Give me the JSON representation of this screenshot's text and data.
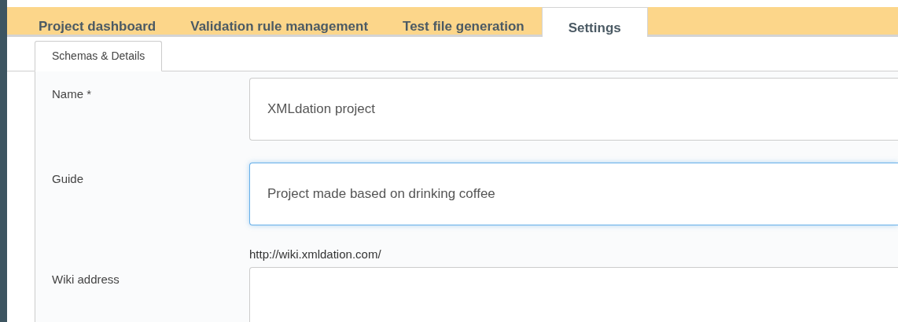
{
  "nav_tabs": [
    {
      "label": "Project dashboard",
      "selected": false
    },
    {
      "label": "Validation rule management",
      "selected": false
    },
    {
      "label": "Test file generation",
      "selected": false
    },
    {
      "label": "Settings",
      "selected": true
    }
  ],
  "sub_tabs": [
    {
      "label": "Schemas & Details",
      "selected": true
    }
  ],
  "form": {
    "fields": [
      {
        "label": "Name *",
        "value": "XMLdation project",
        "focused": false
      },
      {
        "label": "Guide",
        "value": "Project made based on drinking coffee",
        "focused": true
      },
      {
        "label": "Wiki address",
        "helper": "http://wiki.xmldation.com/",
        "focused": false
      }
    ]
  }
}
